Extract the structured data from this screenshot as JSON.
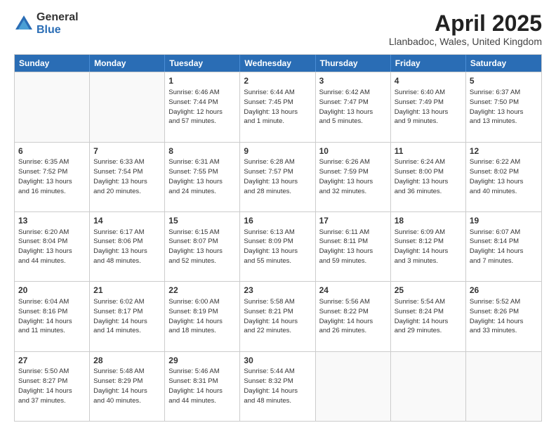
{
  "logo": {
    "general": "General",
    "blue": "Blue"
  },
  "title": "April 2025",
  "subtitle": "Llanbadoc, Wales, United Kingdom",
  "header_days": [
    "Sunday",
    "Monday",
    "Tuesday",
    "Wednesday",
    "Thursday",
    "Friday",
    "Saturday"
  ],
  "rows": [
    [
      {
        "day": "",
        "info": ""
      },
      {
        "day": "",
        "info": ""
      },
      {
        "day": "1",
        "info": "Sunrise: 6:46 AM\nSunset: 7:44 PM\nDaylight: 12 hours\nand 57 minutes."
      },
      {
        "day": "2",
        "info": "Sunrise: 6:44 AM\nSunset: 7:45 PM\nDaylight: 13 hours\nand 1 minute."
      },
      {
        "day": "3",
        "info": "Sunrise: 6:42 AM\nSunset: 7:47 PM\nDaylight: 13 hours\nand 5 minutes."
      },
      {
        "day": "4",
        "info": "Sunrise: 6:40 AM\nSunset: 7:49 PM\nDaylight: 13 hours\nand 9 minutes."
      },
      {
        "day": "5",
        "info": "Sunrise: 6:37 AM\nSunset: 7:50 PM\nDaylight: 13 hours\nand 13 minutes."
      }
    ],
    [
      {
        "day": "6",
        "info": "Sunrise: 6:35 AM\nSunset: 7:52 PM\nDaylight: 13 hours\nand 16 minutes."
      },
      {
        "day": "7",
        "info": "Sunrise: 6:33 AM\nSunset: 7:54 PM\nDaylight: 13 hours\nand 20 minutes."
      },
      {
        "day": "8",
        "info": "Sunrise: 6:31 AM\nSunset: 7:55 PM\nDaylight: 13 hours\nand 24 minutes."
      },
      {
        "day": "9",
        "info": "Sunrise: 6:28 AM\nSunset: 7:57 PM\nDaylight: 13 hours\nand 28 minutes."
      },
      {
        "day": "10",
        "info": "Sunrise: 6:26 AM\nSunset: 7:59 PM\nDaylight: 13 hours\nand 32 minutes."
      },
      {
        "day": "11",
        "info": "Sunrise: 6:24 AM\nSunset: 8:00 PM\nDaylight: 13 hours\nand 36 minutes."
      },
      {
        "day": "12",
        "info": "Sunrise: 6:22 AM\nSunset: 8:02 PM\nDaylight: 13 hours\nand 40 minutes."
      }
    ],
    [
      {
        "day": "13",
        "info": "Sunrise: 6:20 AM\nSunset: 8:04 PM\nDaylight: 13 hours\nand 44 minutes."
      },
      {
        "day": "14",
        "info": "Sunrise: 6:17 AM\nSunset: 8:06 PM\nDaylight: 13 hours\nand 48 minutes."
      },
      {
        "day": "15",
        "info": "Sunrise: 6:15 AM\nSunset: 8:07 PM\nDaylight: 13 hours\nand 52 minutes."
      },
      {
        "day": "16",
        "info": "Sunrise: 6:13 AM\nSunset: 8:09 PM\nDaylight: 13 hours\nand 55 minutes."
      },
      {
        "day": "17",
        "info": "Sunrise: 6:11 AM\nSunset: 8:11 PM\nDaylight: 13 hours\nand 59 minutes."
      },
      {
        "day": "18",
        "info": "Sunrise: 6:09 AM\nSunset: 8:12 PM\nDaylight: 14 hours\nand 3 minutes."
      },
      {
        "day": "19",
        "info": "Sunrise: 6:07 AM\nSunset: 8:14 PM\nDaylight: 14 hours\nand 7 minutes."
      }
    ],
    [
      {
        "day": "20",
        "info": "Sunrise: 6:04 AM\nSunset: 8:16 PM\nDaylight: 14 hours\nand 11 minutes."
      },
      {
        "day": "21",
        "info": "Sunrise: 6:02 AM\nSunset: 8:17 PM\nDaylight: 14 hours\nand 14 minutes."
      },
      {
        "day": "22",
        "info": "Sunrise: 6:00 AM\nSunset: 8:19 PM\nDaylight: 14 hours\nand 18 minutes."
      },
      {
        "day": "23",
        "info": "Sunrise: 5:58 AM\nSunset: 8:21 PM\nDaylight: 14 hours\nand 22 minutes."
      },
      {
        "day": "24",
        "info": "Sunrise: 5:56 AM\nSunset: 8:22 PM\nDaylight: 14 hours\nand 26 minutes."
      },
      {
        "day": "25",
        "info": "Sunrise: 5:54 AM\nSunset: 8:24 PM\nDaylight: 14 hours\nand 29 minutes."
      },
      {
        "day": "26",
        "info": "Sunrise: 5:52 AM\nSunset: 8:26 PM\nDaylight: 14 hours\nand 33 minutes."
      }
    ],
    [
      {
        "day": "27",
        "info": "Sunrise: 5:50 AM\nSunset: 8:27 PM\nDaylight: 14 hours\nand 37 minutes."
      },
      {
        "day": "28",
        "info": "Sunrise: 5:48 AM\nSunset: 8:29 PM\nDaylight: 14 hours\nand 40 minutes."
      },
      {
        "day": "29",
        "info": "Sunrise: 5:46 AM\nSunset: 8:31 PM\nDaylight: 14 hours\nand 44 minutes."
      },
      {
        "day": "30",
        "info": "Sunrise: 5:44 AM\nSunset: 8:32 PM\nDaylight: 14 hours\nand 48 minutes."
      },
      {
        "day": "",
        "info": ""
      },
      {
        "day": "",
        "info": ""
      },
      {
        "day": "",
        "info": ""
      }
    ]
  ]
}
